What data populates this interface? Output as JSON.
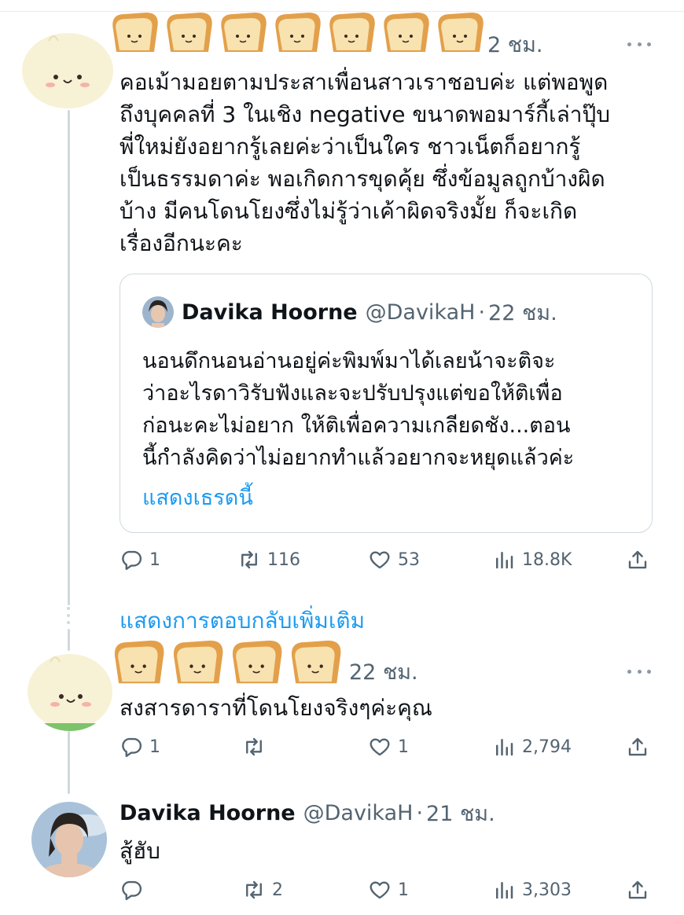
{
  "colors": {
    "link": "#1d9bf0",
    "meta": "#536471",
    "text": "#0f1419",
    "border": "#cfd9de"
  },
  "icons": {
    "reply": "reply-icon",
    "retweet": "retweet-icon",
    "like": "heart-icon",
    "views": "views-icon",
    "share": "share-icon",
    "more": "more-icon",
    "sticker": "bread-sticker-icon"
  },
  "tweet1": {
    "time": "2 ชม.",
    "lines": [
      "คอเม้ามอยตามประสาเพื่อนสาวเราชอบค่ะ แต่พอพูด",
      "ถึงบุคคลที่ 3 ในเชิง negative ขนาดพอมาร์กี้เล่าปุ๊บ",
      "พี่ใหม่ยังอยากรู้เลยค่ะว่าเป็นใคร ชาวเน็ตก็อยากรู้",
      "เป็นธรรมดาค่ะ พอเกิดการขุดคุ้ย ซึ่งข้อมูลถูกบ้างผิด",
      "บ้าง มีคนโดนโยงซึ่งไม่รู้ว่าเค้าผิดจริงมั้ย ก็จะเกิด",
      "เรื่องอีกนะคะ"
    ],
    "quote": {
      "name": "Davika Hoorne",
      "handle": "@DavikaH",
      "dot": "·",
      "time": "22 ชม.",
      "lines": [
        "นอนดึกนอนอ่านอยู่ค่ะพิมพ์มาได้เลยน้าจะติจะ",
        "ว่าอะไรดาวิรับฟังและจะปรับปรุงแต่ขอให้ติเพื่อ",
        "ก่อนะคะไม่อยาก ให้ติเพื่อความเกลียดชัง...ตอน",
        "นี้กำลังคิดว่าไม่อยากทำแล้วอยากจะหยุดแล้วค่ะ"
      ],
      "show_thread": "แสดงเธรดนี้"
    },
    "stats": {
      "replies": "1",
      "retweets": "116",
      "likes": "53",
      "views": "18.8K"
    }
  },
  "show_more_replies": "แสดงการตอบกลับเพิ่มเติม",
  "tweet2": {
    "time": "22 ชม.",
    "text": "สงสารดาราที่โดนโยงจริงๆค่ะคุณ",
    "stats": {
      "replies": "1",
      "retweets": "",
      "likes": "1",
      "views": "2,794"
    }
  },
  "tweet3": {
    "name": "Davika Hoorne",
    "handle": "@DavikaH",
    "dot": "·",
    "time": "21 ชม.",
    "text": "สู้ฮับ",
    "stats": {
      "replies": "",
      "retweets": "2",
      "likes": "1",
      "views": "3,303"
    }
  }
}
